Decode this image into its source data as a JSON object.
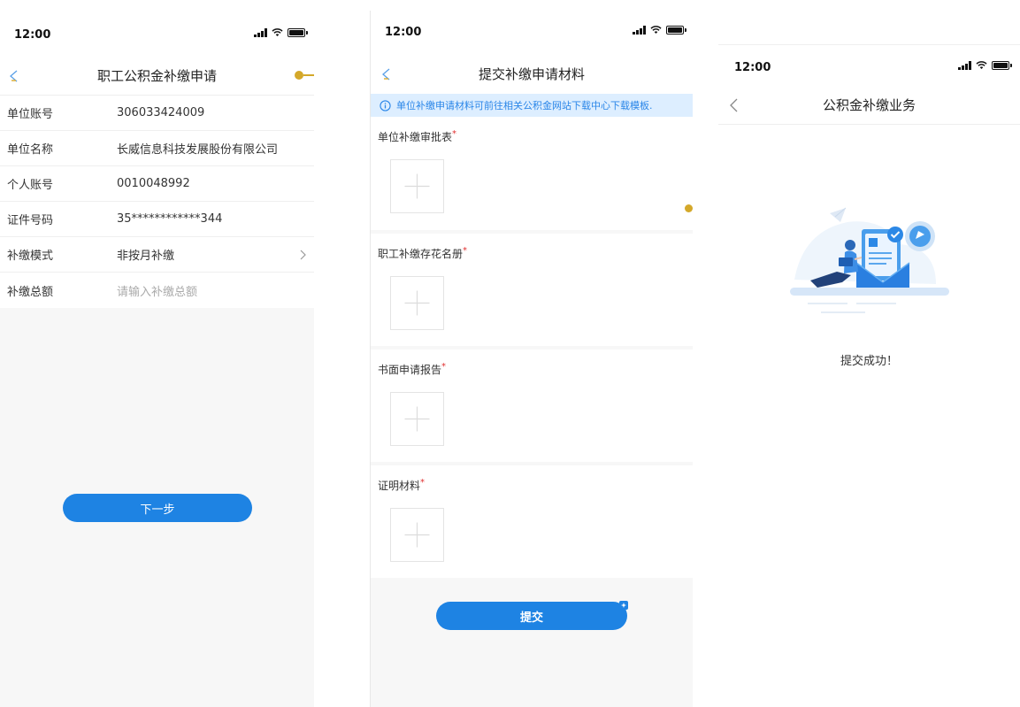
{
  "status": {
    "time": "12:00"
  },
  "screen1": {
    "title": "职工公积金补缴申请",
    "rows": [
      {
        "label": "单位账号",
        "value": "306033424009"
      },
      {
        "label": "单位名称",
        "value": "长威信息科技发展股份有限公司"
      },
      {
        "label": "个人账号",
        "value": "0010048992"
      },
      {
        "label": "证件号码",
        "value": "35************344"
      },
      {
        "label": "补缴模式",
        "value": "非按月补缴"
      }
    ],
    "amount": {
      "label": "补缴总额",
      "placeholder": "请输入补缴总额"
    },
    "next_label": "下一步"
  },
  "screen2": {
    "title": "提交补缴申请材料",
    "notice": "单位补缴申请材料可前往相关公积金网站下载中心下载模板.",
    "required_mark": "*",
    "sections": [
      {
        "label": "单位补缴审批表"
      },
      {
        "label": "职工补缴存花名册"
      },
      {
        "label": "书面申请报告"
      },
      {
        "label": "证明材料"
      }
    ],
    "submit_label": "提交"
  },
  "screen3": {
    "title": "公积金补缴业务",
    "success_text": "提交成功！"
  },
  "colors": {
    "primary": "#1e83e3",
    "notice_bg": "#ddeeff",
    "required": "#e03030"
  }
}
